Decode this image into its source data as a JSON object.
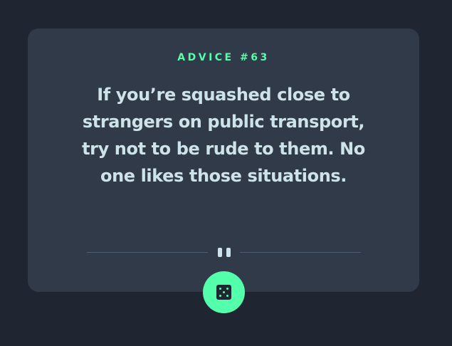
{
  "card": {
    "advice_label": "ADVICE #63",
    "quote": "If you’re squashed close to strangers on public transport, try not to be rude to them. No one likes those situations."
  },
  "icons": {
    "divider": "pause-icon",
    "button": "dice-icon"
  },
  "colors": {
    "background": "#1f2632",
    "card": "#313a48",
    "accent": "#53ffaa",
    "text": "#cee3e9",
    "divider": "#4f5d74"
  }
}
